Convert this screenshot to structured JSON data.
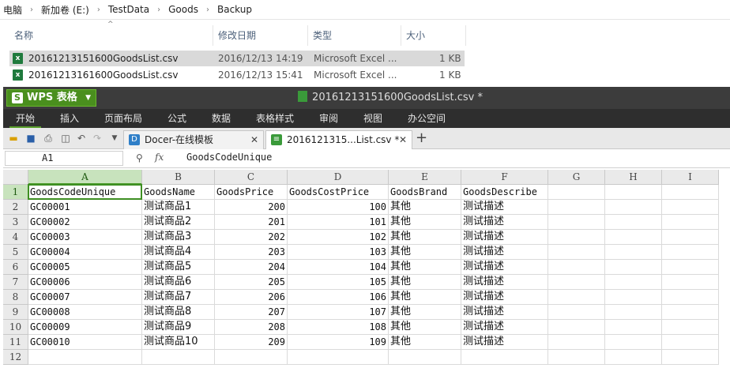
{
  "explorer": {
    "breadcrumb": [
      "电脑",
      "新加卷 (E:)",
      "TestData",
      "Goods",
      "Backup"
    ],
    "columns": {
      "name": "名称",
      "modified": "修改日期",
      "type": "类型",
      "size": "大小"
    },
    "files": [
      {
        "name": "20161213151600GoodsList.csv",
        "modified": "2016/12/13 14:19",
        "type": "Microsoft Excel ...",
        "size": "1 KB",
        "selected": true
      },
      {
        "name": "20161213161600GoodsList.csv",
        "modified": "2016/12/13 15:41",
        "type": "Microsoft Excel ...",
        "size": "1 KB",
        "selected": false
      }
    ]
  },
  "wps": {
    "app_button": "WPS 表格",
    "window_title": "20161213151600GoodsList.csv *",
    "menu": [
      "开始",
      "插入",
      "页面布局",
      "公式",
      "数据",
      "表格样式",
      "审阅",
      "视图",
      "办公空间"
    ],
    "tabs": [
      {
        "label": "Docer-在线模板"
      },
      {
        "label": "2016121315...List.csv *"
      }
    ],
    "tab_close": "✕",
    "new_tab": "+",
    "name_box": "A1",
    "fx_label": "fx",
    "formula": "GoodsCodeUnique"
  },
  "sheet": {
    "columns": [
      "A",
      "B",
      "C",
      "D",
      "E",
      "F",
      "G",
      "H",
      "I"
    ],
    "row_numbers": [
      "1",
      "2",
      "3",
      "4",
      "5",
      "6",
      "7",
      "8",
      "9",
      "10",
      "11",
      "12"
    ],
    "header": [
      "GoodsCodeUnique",
      "GoodsName",
      "GoodsPrice",
      "GoodsCostPrice",
      "GoodsBrand",
      "GoodsDescribe"
    ],
    "rows": [
      [
        "GC00001",
        "测试商品1",
        "200",
        "100",
        "其他",
        "测试描述"
      ],
      [
        "GC00002",
        "测试商品2",
        "201",
        "101",
        "其他",
        "测试描述"
      ],
      [
        "GC00003",
        "测试商品3",
        "202",
        "102",
        "其他",
        "测试描述"
      ],
      [
        "GC00004",
        "测试商品4",
        "203",
        "103",
        "其他",
        "测试描述"
      ],
      [
        "GC00005",
        "测试商品5",
        "204",
        "104",
        "其他",
        "测试描述"
      ],
      [
        "GC00006",
        "测试商品6",
        "205",
        "105",
        "其他",
        "测试描述"
      ],
      [
        "GC00007",
        "测试商品7",
        "206",
        "106",
        "其他",
        "测试描述"
      ],
      [
        "GC00008",
        "测试商品8",
        "207",
        "107",
        "其他",
        "测试描述"
      ],
      [
        "GC00009",
        "测试商品9",
        "208",
        "108",
        "其他",
        "测试描述"
      ],
      [
        "GC00010",
        "测试商品10",
        "209",
        "109",
        "其他",
        "测试描述"
      ]
    ]
  },
  "colors": {
    "accent": "#4a8f1e",
    "titlebar": "#3c3c3c",
    "selection": "#3e8f22"
  }
}
